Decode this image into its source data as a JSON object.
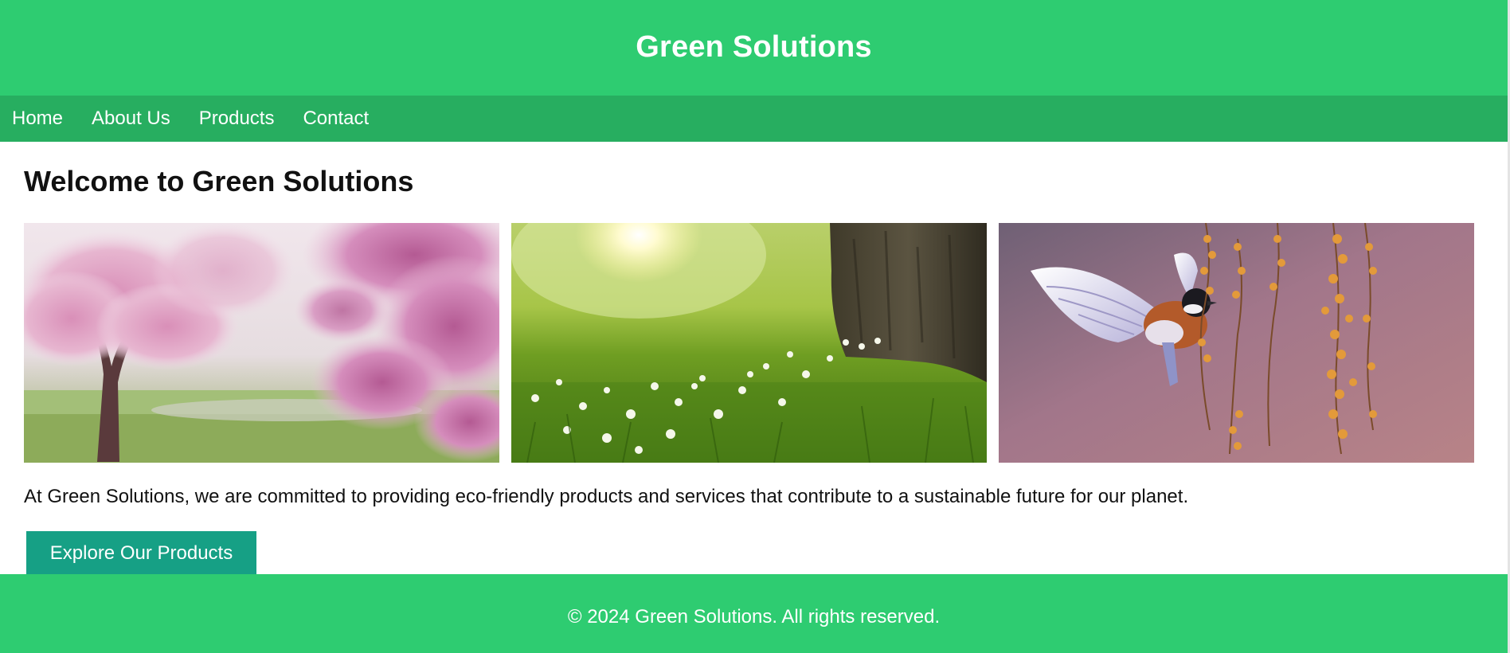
{
  "header": {
    "title": "Green Solutions"
  },
  "nav": {
    "items": [
      {
        "label": "Home"
      },
      {
        "label": "About Us"
      },
      {
        "label": "Products"
      },
      {
        "label": "Contact"
      }
    ]
  },
  "main": {
    "heading": "Welcome to Green Solutions",
    "gallery": [
      {
        "subject": "magnolia-tree-photo"
      },
      {
        "subject": "sunlit-meadow-photo"
      },
      {
        "subject": "bird-in-flight-photo"
      }
    ],
    "intro": "At Green Solutions, we are committed to providing eco-friendly products and services that contribute to a sustainable future for our planet.",
    "cta_label": "Explore Our Products"
  },
  "footer": {
    "text": "© 2024 Green Solutions. All rights reserved."
  },
  "colors": {
    "header_bg": "#2ecc71",
    "nav_bg": "#27ae60",
    "button_bg": "#16a085",
    "footer_bg": "#2ecc71"
  }
}
